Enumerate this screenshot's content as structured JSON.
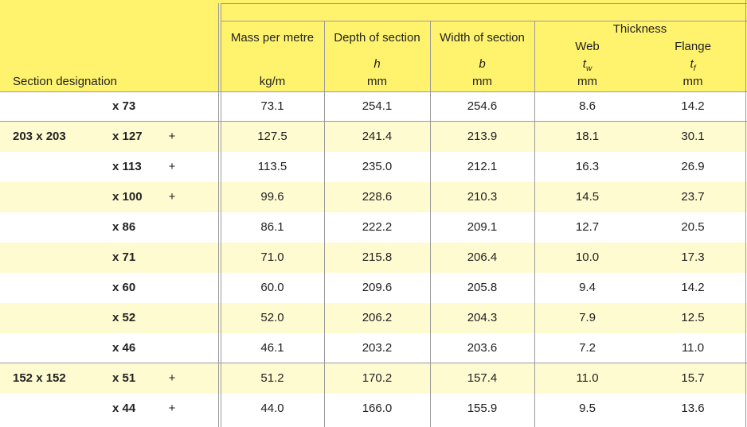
{
  "header": {
    "section_designation": "Section designation",
    "mass": {
      "label": "Mass per metre",
      "unit": "kg/m"
    },
    "depth": {
      "label": "Depth of section",
      "symbol": "h",
      "unit": "mm"
    },
    "width": {
      "label": "Width of section",
      "symbol": "b",
      "unit": "mm"
    },
    "thickness": {
      "label": "Thickness",
      "web": {
        "label": "Web",
        "symbol": "t",
        "sub": "w",
        "unit": "mm"
      },
      "flange": {
        "label": "Flange",
        "symbol": "t",
        "sub": "f",
        "unit": "mm"
      }
    }
  },
  "rows": [
    {
      "serial": "",
      "designation": "x 73",
      "mark": "",
      "mass": "73.1",
      "depth": "254.1",
      "width": "254.6",
      "web": "8.6",
      "flange": "14.2"
    },
    {
      "serial": "203 x 203",
      "designation": "x 127",
      "mark": "+",
      "mass": "127.5",
      "depth": "241.4",
      "width": "213.9",
      "web": "18.1",
      "flange": "30.1"
    },
    {
      "serial": "",
      "designation": "x 113",
      "mark": "+",
      "mass": "113.5",
      "depth": "235.0",
      "width": "212.1",
      "web": "16.3",
      "flange": "26.9"
    },
    {
      "serial": "",
      "designation": "x 100",
      "mark": "+",
      "mass": "99.6",
      "depth": "228.6",
      "width": "210.3",
      "web": "14.5",
      "flange": "23.7"
    },
    {
      "serial": "",
      "designation": "x 86",
      "mark": "",
      "mass": "86.1",
      "depth": "222.2",
      "width": "209.1",
      "web": "12.7",
      "flange": "20.5"
    },
    {
      "serial": "",
      "designation": "x 71",
      "mark": "",
      "mass": "71.0",
      "depth": "215.8",
      "width": "206.4",
      "web": "10.0",
      "flange": "17.3"
    },
    {
      "serial": "",
      "designation": "x 60",
      "mark": "",
      "mass": "60.0",
      "depth": "209.6",
      "width": "205.8",
      "web": "9.4",
      "flange": "14.2"
    },
    {
      "serial": "",
      "designation": "x 52",
      "mark": "",
      "mass": "52.0",
      "depth": "206.2",
      "width": "204.3",
      "web": "7.9",
      "flange": "12.5"
    },
    {
      "serial": "",
      "designation": "x 46",
      "mark": "",
      "mass": "46.1",
      "depth": "203.2",
      "width": "203.6",
      "web": "7.2",
      "flange": "11.0"
    },
    {
      "serial": "152 x 152",
      "designation": "x 51",
      "mark": "+",
      "mass": "51.2",
      "depth": "170.2",
      "width": "157.4",
      "web": "11.0",
      "flange": "15.7"
    },
    {
      "serial": "",
      "designation": "x 44",
      "mark": "+",
      "mass": "44.0",
      "depth": "166.0",
      "width": "155.9",
      "web": "9.5",
      "flange": "13.6"
    }
  ],
  "colors": {
    "header": "#fff36e",
    "alt_row": "#fffbd1",
    "white_row": "#ffffff",
    "border": "#9a9a9a"
  }
}
